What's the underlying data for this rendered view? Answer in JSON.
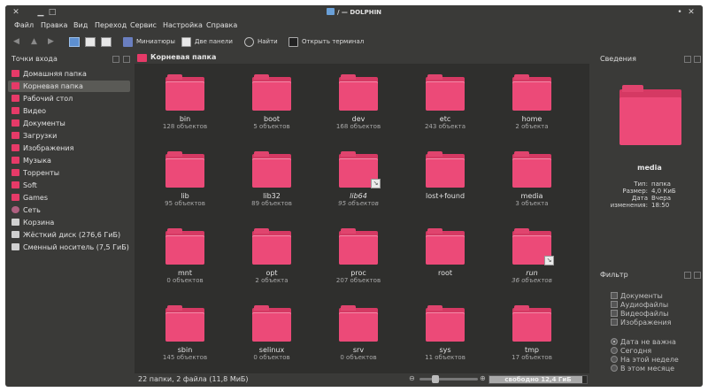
{
  "window": {
    "title": "/ — DOLPHIN"
  },
  "menu": [
    "Файл",
    "Правка",
    "Вид",
    "Переход",
    "Сервис",
    "Настройка",
    "Справка"
  ],
  "toolbar": {
    "miniatures": "Миниатюры",
    "two_panels": "Две панели",
    "find": "Найти",
    "open_terminal": "Открыть терминал"
  },
  "places": {
    "title": "Точки входа",
    "items": [
      {
        "label": "Домашняя папка",
        "icon": "home-folder-icon"
      },
      {
        "label": "Корневая папка",
        "icon": "root-folder-icon"
      },
      {
        "label": "Рабочий стол",
        "icon": "desktop-icon"
      },
      {
        "label": "Видео",
        "icon": "video-folder-icon"
      },
      {
        "label": "Документы",
        "icon": "documents-folder-icon"
      },
      {
        "label": "Загрузки",
        "icon": "downloads-folder-icon"
      },
      {
        "label": "Изображения",
        "icon": "pictures-folder-icon"
      },
      {
        "label": "Музыка",
        "icon": "music-folder-icon"
      },
      {
        "label": "Торренты",
        "icon": "folder-icon"
      },
      {
        "label": "Soft",
        "icon": "folder-icon"
      },
      {
        "label": "Games",
        "icon": "folder-icon"
      },
      {
        "label": "Сеть",
        "icon": "network-icon"
      },
      {
        "label": "Корзина",
        "icon": "trash-icon"
      },
      {
        "label": "Жёсткий диск (276,6 ГиБ)",
        "icon": "hard-disk-icon"
      },
      {
        "label": "Сменный носитель (7,5 ГиБ)",
        "icon": "removable-drive-icon"
      }
    ],
    "selected_index": 1
  },
  "location": {
    "title": "Корневая папка"
  },
  "files": [
    {
      "name": "bin",
      "count": "128 объектов",
      "link": false
    },
    {
      "name": "boot",
      "count": "5 объектов",
      "link": false
    },
    {
      "name": "dev",
      "count": "168 объектов",
      "link": false
    },
    {
      "name": "etc",
      "count": "243 объекта",
      "link": false
    },
    {
      "name": "home",
      "count": "2 объекта",
      "link": false
    },
    {
      "name": "lib",
      "count": "95 объектов",
      "link": false
    },
    {
      "name": "lib32",
      "count": "89 объектов",
      "link": false
    },
    {
      "name": "lib64",
      "count": "95 объектов",
      "link": true
    },
    {
      "name": "lost+found",
      "count": "",
      "link": false
    },
    {
      "name": "media",
      "count": "3 объекта",
      "link": false
    },
    {
      "name": "mnt",
      "count": "0 объектов",
      "link": false
    },
    {
      "name": "opt",
      "count": "2 объекта",
      "link": false
    },
    {
      "name": "proc",
      "count": "207 объектов",
      "link": false
    },
    {
      "name": "root",
      "count": "",
      "link": false
    },
    {
      "name": "run",
      "count": "36 объектов",
      "link": true
    },
    {
      "name": "sbin",
      "count": "145 объектов",
      "link": false
    },
    {
      "name": "selinux",
      "count": "0 объектов",
      "link": false
    },
    {
      "name": "srv",
      "count": "0 объектов",
      "link": false
    },
    {
      "name": "sys",
      "count": "11 объектов",
      "link": false
    },
    {
      "name": "tmp",
      "count": "17 объектов",
      "link": false
    }
  ],
  "status": {
    "summary": "22 папки, 2 файла (11,8 МиБ)",
    "free_space": "свободно 12,4 ГиБ",
    "used_fraction": 0.95
  },
  "info": {
    "title": "Сведения",
    "name": "media",
    "rows": [
      {
        "key": "Тип:",
        "value": "папка"
      },
      {
        "key": "Размер:",
        "value": "4,0 КиБ"
      },
      {
        "key": "Дата",
        "value": "Вчера"
      },
      {
        "key": "изменения:",
        "value": "18:50"
      }
    ]
  },
  "filter": {
    "title": "Фильтр",
    "types": [
      "Документы",
      "Аудиофайлы",
      "Видеофайлы",
      "Изображения"
    ],
    "dates": [
      "Дата не важна",
      "Сегодня",
      "На этой неделе",
      "В этом месяце"
    ],
    "selected_date": 0
  },
  "colors": {
    "folder": "#ec4a78",
    "background": "#3a3a38",
    "view_bg": "#2f2f2d"
  }
}
